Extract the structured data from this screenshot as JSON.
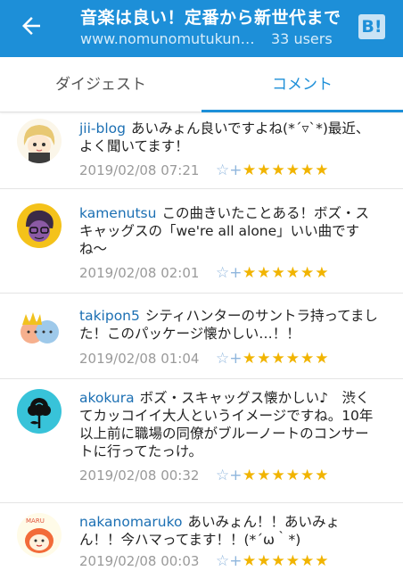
{
  "header": {
    "title": "音楽は良い！定番から新世代まで",
    "url": "www.nomunomutukune.com",
    "users": "33 users",
    "bookmark_label": "B!"
  },
  "tabs": [
    {
      "label": "ダイジェスト"
    },
    {
      "label": "コメント"
    }
  ],
  "comments": [
    {
      "user": "jii-blog",
      "text": "あいみょん良いですよね(*´▿`*)最近、よく聞いてます！",
      "date": "2019/02/08 07:21",
      "add_star": "☆+",
      "stars": "★★★★★★"
    },
    {
      "user": "kamenutsu",
      "text": "この曲きいたことある！ボズ・スキャッグスの「we're all alone」いい曲ですね〜",
      "date": "2019/02/08 02:01",
      "add_star": "☆+",
      "stars": "★★★★★★"
    },
    {
      "user": "takipon5",
      "text": "シティハンターのサントラ持ってました！このパッケージ懐かしい…！！",
      "date": "2019/02/08 01:04",
      "add_star": "☆+",
      "stars": "★★★★★★"
    },
    {
      "user": "akokura",
      "text": "ボズ・スキャッグス懐かしい♪　渋くてカッコイイ大人というイメージですね。10年以上前に職場の同僚がブルーノートのコンサートに行ってたっけ。",
      "date": "2019/02/08 00:32",
      "add_star": "☆+",
      "stars": "★★★★★★"
    },
    {
      "user": "nakanomaruko",
      "text": "あいみょん！！あいみょん！！今ハマってます！！(*´ω｀*)",
      "date": "2019/02/08 00:03",
      "add_star": "☆+",
      "stars": "★★★★★★"
    }
  ]
}
